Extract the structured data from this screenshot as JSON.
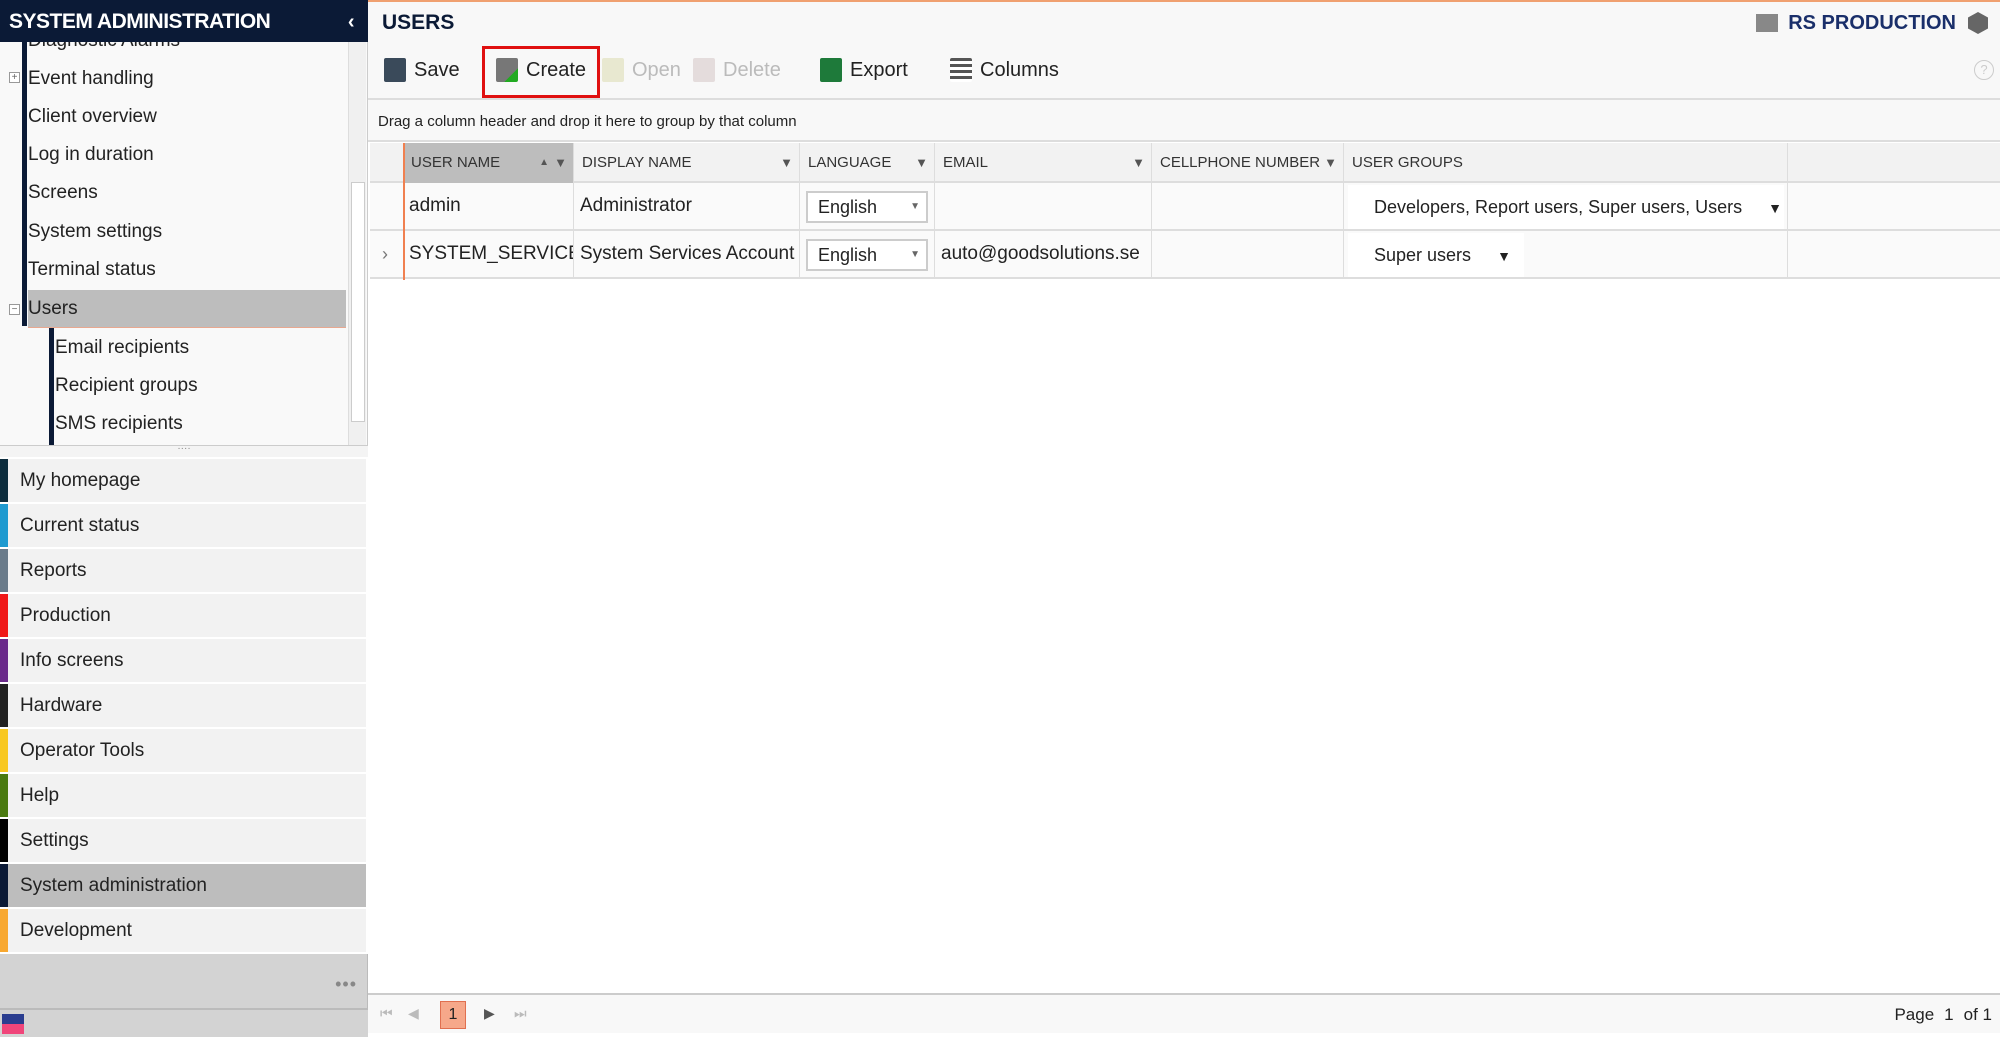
{
  "sidebar": {
    "title": "SYSTEM ADMINISTRATION",
    "collapse_icon": "‹",
    "tree": [
      {
        "label": "Diagnostic Alarms",
        "level": 1
      },
      {
        "label": "Event handling",
        "level": 1,
        "expander": "+"
      },
      {
        "label": "Client overview",
        "level": 1
      },
      {
        "label": "Log in duration",
        "level": 1
      },
      {
        "label": "Screens",
        "level": 1
      },
      {
        "label": "System settings",
        "level": 1
      },
      {
        "label": "Terminal status",
        "level": 1
      },
      {
        "label": "Users",
        "level": 1,
        "expander": "−",
        "selected": true
      },
      {
        "label": "Email recipients",
        "level": 2
      },
      {
        "label": "Recipient groups",
        "level": 2
      },
      {
        "label": "SMS recipients",
        "level": 2
      }
    ],
    "nav": [
      {
        "label": "My homepage",
        "color": "#0e2e3e"
      },
      {
        "label": "Current status",
        "color": "#1e9ad0"
      },
      {
        "label": "Reports",
        "color": "#6a7b8a"
      },
      {
        "label": "Production",
        "color": "#f01818"
      },
      {
        "label": "Info screens",
        "color": "#6a2a8a"
      },
      {
        "label": "Hardware",
        "color": "#222222"
      },
      {
        "label": "Operator Tools",
        "color": "#f8c820"
      },
      {
        "label": "Help",
        "color": "#4a7a10"
      },
      {
        "label": "Settings",
        "color": "#000000"
      },
      {
        "label": "System administration",
        "color": "#0b1a36",
        "active": true
      },
      {
        "label": "Development",
        "color": "#f8a830"
      }
    ],
    "more_icon": "•••"
  },
  "header": {
    "title": "USERS",
    "brand": "RS PRODUCTION"
  },
  "toolbar": {
    "save": "Save",
    "create": "Create",
    "open": "Open",
    "delete": "Delete",
    "export": "Export",
    "columns": "Columns",
    "help": "?"
  },
  "group_hint": "Drag a column header and drop it here to group by that column",
  "grid": {
    "columns": [
      "USER NAME",
      "DISPLAY NAME",
      "LANGUAGE",
      "EMAIL",
      "CELLPHONE NUMBER",
      "USER GROUPS"
    ],
    "sort_icon": "▲",
    "filter_icon": "▼",
    "rows": [
      {
        "user": "admin",
        "display": "Administrator",
        "language": "English",
        "email": "",
        "cell": "",
        "groups": "Developers, Report users, Super users, Users"
      },
      {
        "user": "SYSTEM_SERVICES",
        "display": "System Services Account",
        "language": "English",
        "email": "auto@goodsolutions.se",
        "cell": "",
        "groups": "Super users",
        "expand": "›"
      }
    ]
  },
  "pager": {
    "current": "1",
    "page_label": "Page",
    "page": "1",
    "of_label": "of 1"
  },
  "colors": {
    "accent": "#f08050",
    "navy": "#0b1a36",
    "highlight": "#e01010"
  }
}
